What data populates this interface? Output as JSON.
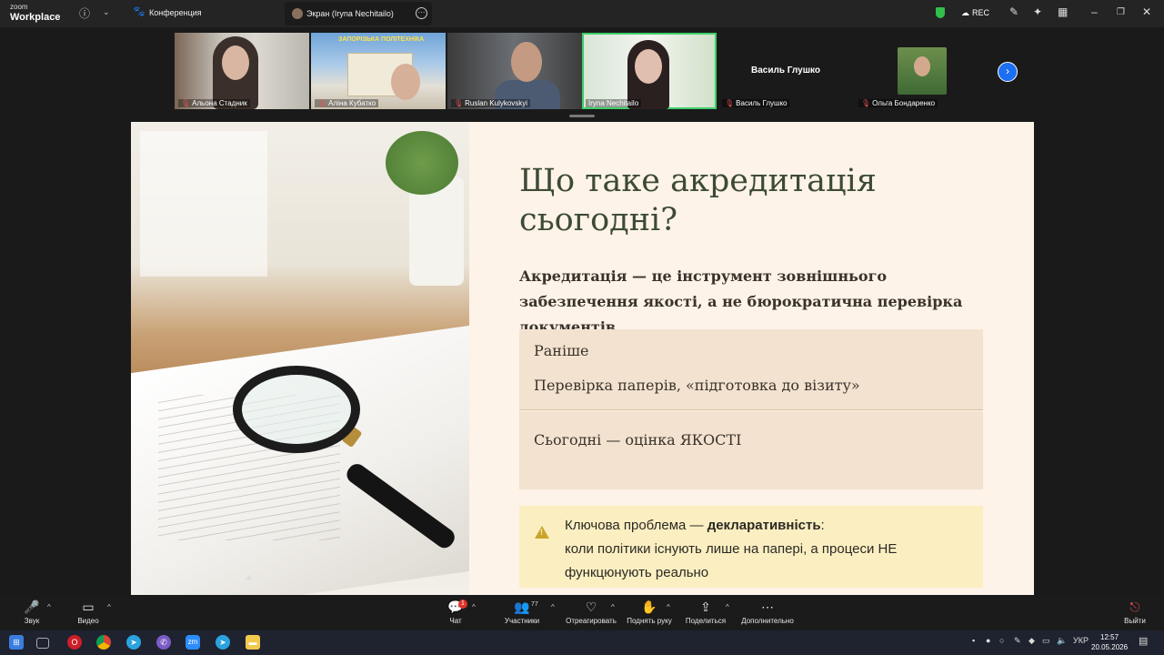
{
  "app": {
    "logo_top": "zoom",
    "logo_bottom": "Workplace"
  },
  "topbar": {
    "meeting_label": "Конференция",
    "screen_tab": "Экран (Iryna Nechitailo)",
    "rec_label": "REC",
    "icons": [
      "info-icon",
      "chevron-down-icon",
      "paw-icon",
      "shield-icon",
      "cloud-icon",
      "pencil-icon",
      "sparkle-icon",
      "calendar-icon"
    ]
  },
  "participants": [
    {
      "name": "Альона Стадник",
      "muted": true
    },
    {
      "name": "Аліна Кубатко",
      "muted": true,
      "banner": "ЗАПОРІЗЬКА ПОЛІТЕХНІКА"
    },
    {
      "name": "Ruslan Kulykovskyi",
      "muted": true
    },
    {
      "name": "Iryna Nechitailo",
      "muted": false,
      "active_speaker": true
    },
    {
      "name": "Василь Глушко",
      "muted": true,
      "video_off": true
    },
    {
      "name": "Ольга Бондаренко",
      "muted": true
    }
  ],
  "slide": {
    "title": "Що таке акредитація сьогодні?",
    "subtitle": "Акредитація — це інструмент зовнішнього забезпечення якості, а не бюрократична перевірка документів",
    "before_heading": "Раніше",
    "before_text": "Перевірка паперів, «підготовка до візиту»",
    "today_heading": "Сьогодні — оцінка ЯКОСТІ",
    "warning_lead": "Ключова проблема — ",
    "warning_bold": "декларативність",
    "warning_colon": ":",
    "warning_rest": "коли політики існують лише на папері, а процеси НЕ функцюнують реально"
  },
  "toolbar": {
    "audio": "Звук",
    "video": "Видео",
    "chat": "Чат",
    "chat_badge": "1",
    "participants": "Участники",
    "participants_count": "77",
    "react": "Отреагировать",
    "raise_hand": "Поднять руку",
    "share": "Поделиться",
    "more": "Дополнительно",
    "leave": "Выйти"
  },
  "taskbar": {
    "lang": "УКР",
    "time": "12:57",
    "date": "20.05.2026"
  },
  "colors": {
    "accent_blue": "#1c6ff2",
    "active_green": "#3fcf6a",
    "slide_bg": "#fdf3e8",
    "title_green": "#3d4a35",
    "warning_bg": "#fbefc2"
  }
}
